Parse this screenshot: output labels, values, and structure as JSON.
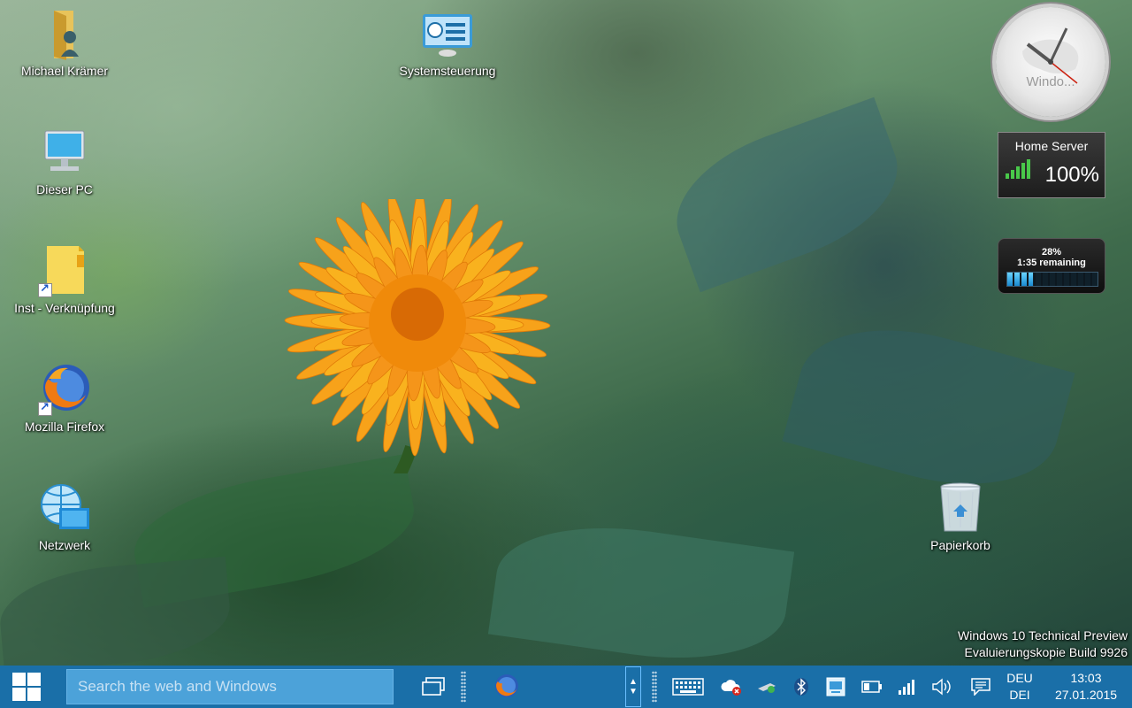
{
  "desktop": {
    "icons": [
      {
        "label": "Michael Krämer",
        "icon": "user-folder-icon"
      },
      {
        "label": "Systemsteuerung",
        "icon": "control-panel-icon"
      },
      {
        "label": "Dieser PC",
        "icon": "computer-icon"
      },
      {
        "label": "Inst - Verknüpfung",
        "icon": "folder-shortcut-icon"
      },
      {
        "label": "Mozilla Firefox",
        "icon": "firefox-icon"
      },
      {
        "label": "Netzwerk",
        "icon": "network-icon"
      },
      {
        "label": "Papierkorb",
        "icon": "recycle-bin-icon"
      }
    ],
    "watermark": {
      "line1": "Windows 10 Technical Preview",
      "line2": "Evaluierungskopie Build 9926"
    }
  },
  "gadgets": {
    "clock": {
      "label": "Windo..."
    },
    "home_server": {
      "title": "Home Server",
      "value": "100%"
    },
    "battery": {
      "percent": "28%",
      "remaining": "1:35 remaining",
      "level": 0.28
    }
  },
  "taskbar": {
    "start_icon": "windows-logo-icon",
    "search_placeholder": "Search the web and Windows",
    "task_view_icon": "task-view-icon",
    "pinned": [
      {
        "app": "Mozilla Firefox",
        "icon": "firefox-icon"
      }
    ],
    "tray": [
      {
        "icon": "keyboard-icon"
      },
      {
        "icon": "cloud-sync-error-icon"
      },
      {
        "icon": "network-adapter-icon"
      },
      {
        "icon": "bluetooth-icon"
      },
      {
        "icon": "display-icon"
      },
      {
        "icon": "battery-icon"
      },
      {
        "icon": "signal-strength-icon"
      },
      {
        "icon": "volume-icon"
      },
      {
        "icon": "action-center-icon"
      }
    ],
    "language": {
      "line1": "DEU",
      "line2": "DEI"
    },
    "clock": {
      "time": "13:03",
      "date": "27.01.2015"
    },
    "colors": {
      "taskbar": "#1a6fa8",
      "search": "#4ca2d9"
    }
  }
}
